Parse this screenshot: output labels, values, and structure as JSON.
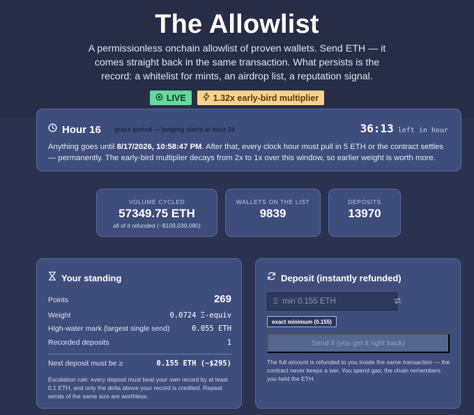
{
  "hero": {
    "title": "The Allowlist",
    "subtitle": "A permissionless onchain allowlist of proven wallets. Send ETH — it comes straight back in the same transaction. What persists is the record: a whitelist for mints, an airdrop list, a reputation signal.",
    "live_badge": "LIVE",
    "multiplier_badge": "1.32x early-bird multiplier"
  },
  "hour": {
    "title": "Hour 16",
    "grace": "grace period — judging starts at hour 24",
    "countdown": "36:13",
    "countdown_label": "left in hour",
    "text_pre": "Anything goes until ",
    "deadline": "8/17/2026, 10:58:47 PM",
    "text_post": ". After that, every clock hour must pull in 5 ETH or the contract settles — permanently. The early-bird multiplier decays from 2x to 1x over this window, so earlier weight is worth more."
  },
  "stats": [
    {
      "label": "VOLUME CYCLED",
      "value": "57349.75 ETH",
      "sub": "all of it refunded (~$109,039,080)"
    },
    {
      "label": "WALLETS ON THE LIST",
      "value": "9839",
      "sub": ""
    },
    {
      "label": "DEPOSITS",
      "value": "13970",
      "sub": ""
    }
  ],
  "standing": {
    "title": "Your standing",
    "points_label": "Points",
    "points_value": "269",
    "weight_label": "Weight",
    "weight_value": "0.0724 Ξ-equiv",
    "hwm_label": "High-water mark (largest single send)",
    "hwm_value": "0.055 ETH",
    "recorded_label": "Recorded deposits",
    "recorded_value": "1",
    "next_label": "Next deposit must be ≥",
    "next_value": "0.155 ETH (~$295)",
    "rule": "Escalation rule: every deposit must beat your own record by at least 0.1 ETH, and only the delta above your record is credited. Repeat sends of the same size are worthless."
  },
  "deposit": {
    "title": "Deposit (instantly refunded)",
    "currency_symbol": "Ξ",
    "amount_value": "",
    "placeholder": "min 0.155 ETH",
    "min_button": "exact minimum (0.155)",
    "send_button": "Send it (you get it right back)",
    "note": "The full amount is refunded to you inside the same transaction — the contract never keeps a wei. You spend gas; the chain remembers you held the ETH."
  },
  "colors": {
    "background": "#2b3350",
    "card": "#3e4d7c",
    "live_badge": "#63d99b",
    "multiplier_badge": "#f6d28c"
  },
  "icons": {
    "live": "circle-dot-icon",
    "multiplier": "lightning-icon",
    "hour": "clock-icon",
    "standing": "hourglass-icon",
    "deposit": "refresh-icon",
    "swap": "swap-arrows-icon"
  }
}
